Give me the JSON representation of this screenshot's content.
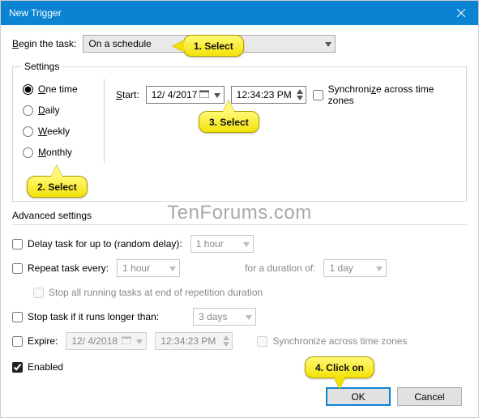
{
  "window": {
    "title": "New Trigger"
  },
  "begin": {
    "label_pre": "B",
    "label_post": "egin the task:",
    "value": "On a schedule"
  },
  "settings": {
    "legend": "Settings",
    "start_label_pre": "S",
    "start_label_post": "tart:",
    "date": "12/ 4/2017",
    "time": "12:34:23 PM",
    "sync_pre": "Synchroni",
    "sync_u": "z",
    "sync_post": "e across time zones",
    "radios": {
      "one_u": "O",
      "one_post": "ne time",
      "daily_u": "D",
      "daily_post": "aily",
      "weekly_u": "W",
      "weekly_post": "eekly",
      "monthly_u": "M",
      "monthly_post": "onthly"
    }
  },
  "adv": {
    "legend": "Advanced settings",
    "delay_label": "Delay task for up to (random delay):",
    "delay_value": "1 hour",
    "repeat_label": "Repeat task every:",
    "repeat_value": "1 hour",
    "duration_label": "for a duration of:",
    "duration_value": "1 day",
    "stop_all_label": "Stop all running tasks at end of repetition duration",
    "stop_longer_label": "Stop task if it runs longer than:",
    "stop_longer_value": "3 days",
    "expire_label": "Expire:",
    "expire_date": "12/ 4/2018",
    "expire_time": "12:34:23 PM",
    "expire_sync": "Synchronize across time zones",
    "enabled_label": "Enabled"
  },
  "buttons": {
    "ok": "OK",
    "cancel": "Cancel"
  },
  "callouts": {
    "c1": "1. Select",
    "c2": "2. Select",
    "c3": "3. Select",
    "c4": "4. Click on"
  },
  "watermark": "TenForums.com"
}
